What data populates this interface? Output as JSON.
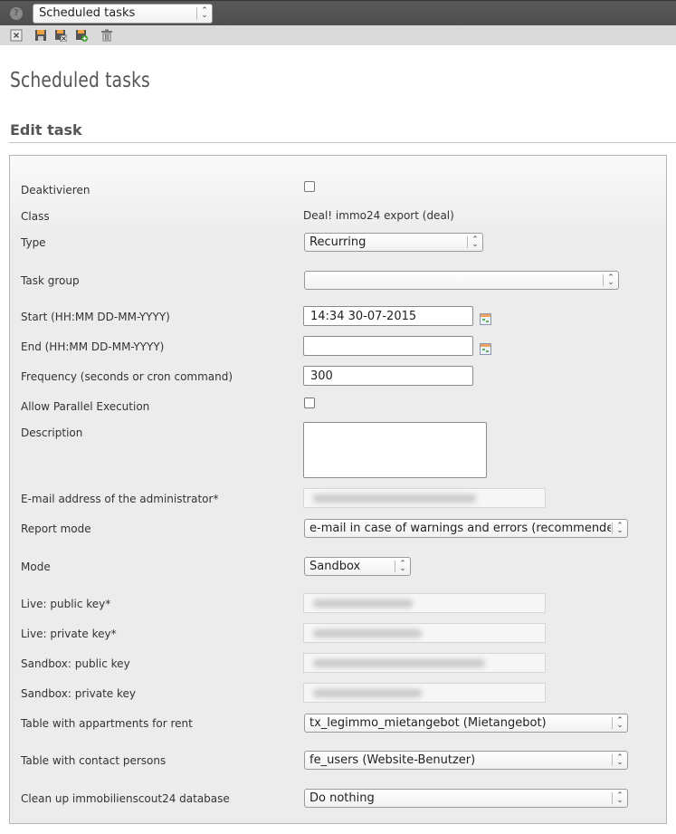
{
  "topbar": {
    "help_icon": "help-icon",
    "module_select_value": "Scheduled tasks"
  },
  "toolbar": {
    "icons": [
      "close-icon",
      "save-icon",
      "save-and-close-icon",
      "save-and-new-icon",
      "delete-icon"
    ]
  },
  "page": {
    "title": "Scheduled tasks",
    "section_title": "Edit task"
  },
  "form": {
    "deactivate": {
      "label": "Deaktivieren",
      "checked": false
    },
    "class": {
      "label": "Class",
      "value": "Deal! immo24 export (deal)"
    },
    "type": {
      "label": "Type",
      "value": "Recurring"
    },
    "task_group": {
      "label": "Task group",
      "value": ""
    },
    "start": {
      "label": "Start (HH:MM DD-MM-YYYY)",
      "value": "14:34 30-07-2015"
    },
    "end": {
      "label": "End (HH:MM DD-MM-YYYY)",
      "value": ""
    },
    "frequency": {
      "label": "Frequency (seconds or cron command)",
      "value": "300"
    },
    "parallel": {
      "label": "Allow Parallel Execution",
      "checked": false
    },
    "description": {
      "label": "Description",
      "value": ""
    },
    "admin_email": {
      "label": "E-mail address of the administrator*",
      "value": "[redacted]"
    },
    "report_mode": {
      "label": "Report mode",
      "value": "e-mail in case of warnings and errors (recommended)"
    },
    "mode": {
      "label": "Mode",
      "value": "Sandbox"
    },
    "live_public_key": {
      "label": "Live: public key*",
      "value": "[redacted]"
    },
    "live_private_key": {
      "label": "Live: private key*",
      "value": "[redacted]"
    },
    "sandbox_public_key": {
      "label": "Sandbox: public key",
      "value": "[redacted]"
    },
    "sandbox_private_key": {
      "label": "Sandbox: private key",
      "value": "[redacted]"
    },
    "rent_table": {
      "label": "Table with appartments for rent",
      "value": "tx_legimmo_mietangebot (Mietangebot)"
    },
    "contact_table": {
      "label": "Table with contact persons",
      "value": "fe_users (Website-Benutzer)"
    },
    "cleanup": {
      "label": "Clean up immobilienscout24 database",
      "value": "Do nothing"
    }
  }
}
